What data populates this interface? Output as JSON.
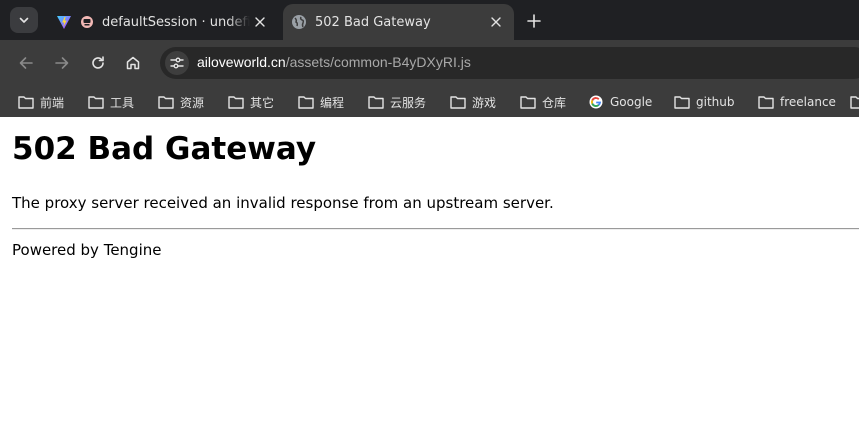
{
  "browser": {
    "tabs": [
      {
        "title": "defaultSession · undefined",
        "active": false,
        "favicon": "vite-logo-icon"
      },
      {
        "title": "502 Bad Gateway",
        "active": true,
        "favicon": "globe-icon"
      }
    ],
    "address": {
      "host": "ailoveworld.cn",
      "path": "/assets/common-B4yDXyRI.js"
    },
    "bookmarks": [
      {
        "label": "前端",
        "icon": "folder-icon"
      },
      {
        "label": "工具",
        "icon": "folder-icon"
      },
      {
        "label": "资源",
        "icon": "folder-icon"
      },
      {
        "label": "其它",
        "icon": "folder-icon"
      },
      {
        "label": "编程",
        "icon": "folder-icon"
      },
      {
        "label": "云服务",
        "icon": "folder-icon"
      },
      {
        "label": "游戏",
        "icon": "folder-icon"
      },
      {
        "label": "仓库",
        "icon": "folder-icon"
      },
      {
        "label": "Google",
        "icon": "google-g-icon"
      },
      {
        "label": "github",
        "icon": "folder-icon"
      },
      {
        "label": "freelance",
        "icon": "folder-icon"
      }
    ]
  },
  "page": {
    "heading": "502 Bad Gateway",
    "message": "The proxy server received an invalid response from an upstream server.",
    "footer": "Powered by Tengine"
  },
  "colors": {
    "tab_strip_bg": "#1f2023",
    "toolbar_bg": "#3c3c3c",
    "omnibox_bg": "#282828",
    "page_bg": "#ffffff"
  }
}
